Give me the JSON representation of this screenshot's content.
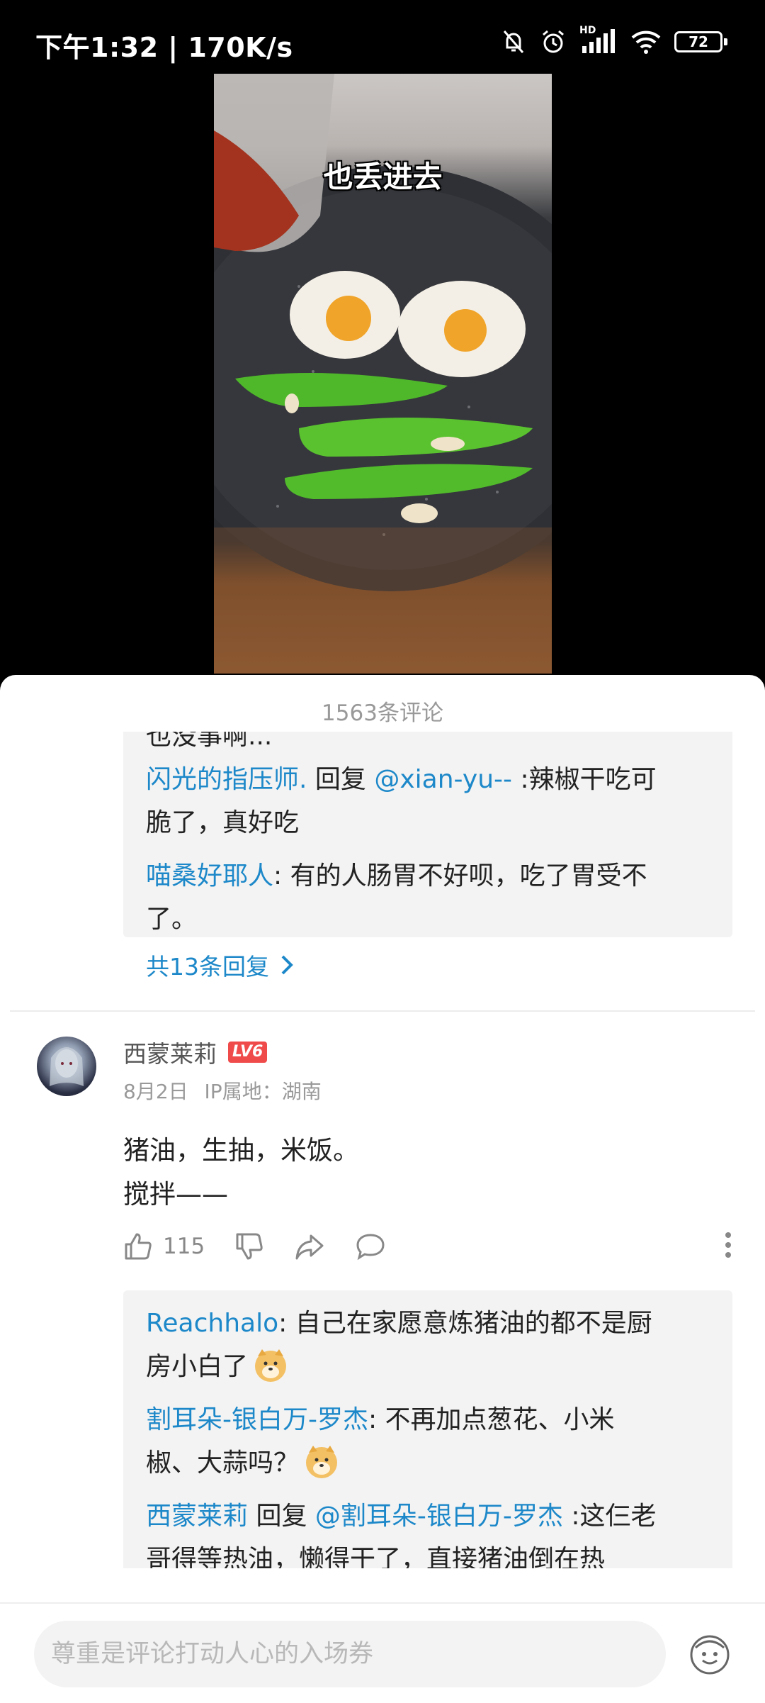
{
  "status_bar": {
    "time_speed": "下午1:32 | 170K/s",
    "hd_label": "HD",
    "battery": "72"
  },
  "video": {
    "caption": "也丢进去"
  },
  "comments": {
    "header": "1563条评论",
    "top_reply_thread": {
      "cut_line": "也没事啊...",
      "replies": [
        {
          "user": "闪光的指压师.",
          "reply_word": " 回复 ",
          "reply_to": "@xian-yu--",
          "text_1": " :辣椒干吃可",
          "text_2": "脆了，真好吃"
        },
        {
          "user": "喵桑好耶人",
          "text_1": ": 有的人肠胃不好呗，吃了胃受不",
          "text_2": "了。"
        }
      ],
      "more_label": "共13条回复"
    },
    "comment": {
      "user": "西蒙莱莉",
      "level": "LV6",
      "date": "8月2日",
      "ip": "IP属地：湖南",
      "text_line1": "猪油，生抽，米饭。",
      "text_line2": "搅拌——",
      "like_count": "115",
      "replies": [
        {
          "user": "Reachhalo",
          "text_1": ": 自己在家愿意炼猪油的都不是厨",
          "text_2": "房小白了",
          "emoji": "doge-emoji"
        },
        {
          "user": "割耳朵-银白万-罗杰",
          "text_1": ": 不再加点葱花、小米",
          "text_2": "椒、大蒜吗？",
          "emoji": "doge-emoji"
        },
        {
          "user": "西蒙莱莉",
          "reply_word": " 回复 ",
          "reply_to": "@割耳朵-银白万-罗杰",
          "text_1": " :这仨老",
          "text_2": "哥得等热油，懒得干了，直接猪油倒在热"
        }
      ]
    }
  },
  "input_bar": {
    "placeholder": "尊重是评论打动人心的入场券"
  },
  "colors": {
    "link": "#1d88c9",
    "level_badge": "#f04b4b"
  }
}
